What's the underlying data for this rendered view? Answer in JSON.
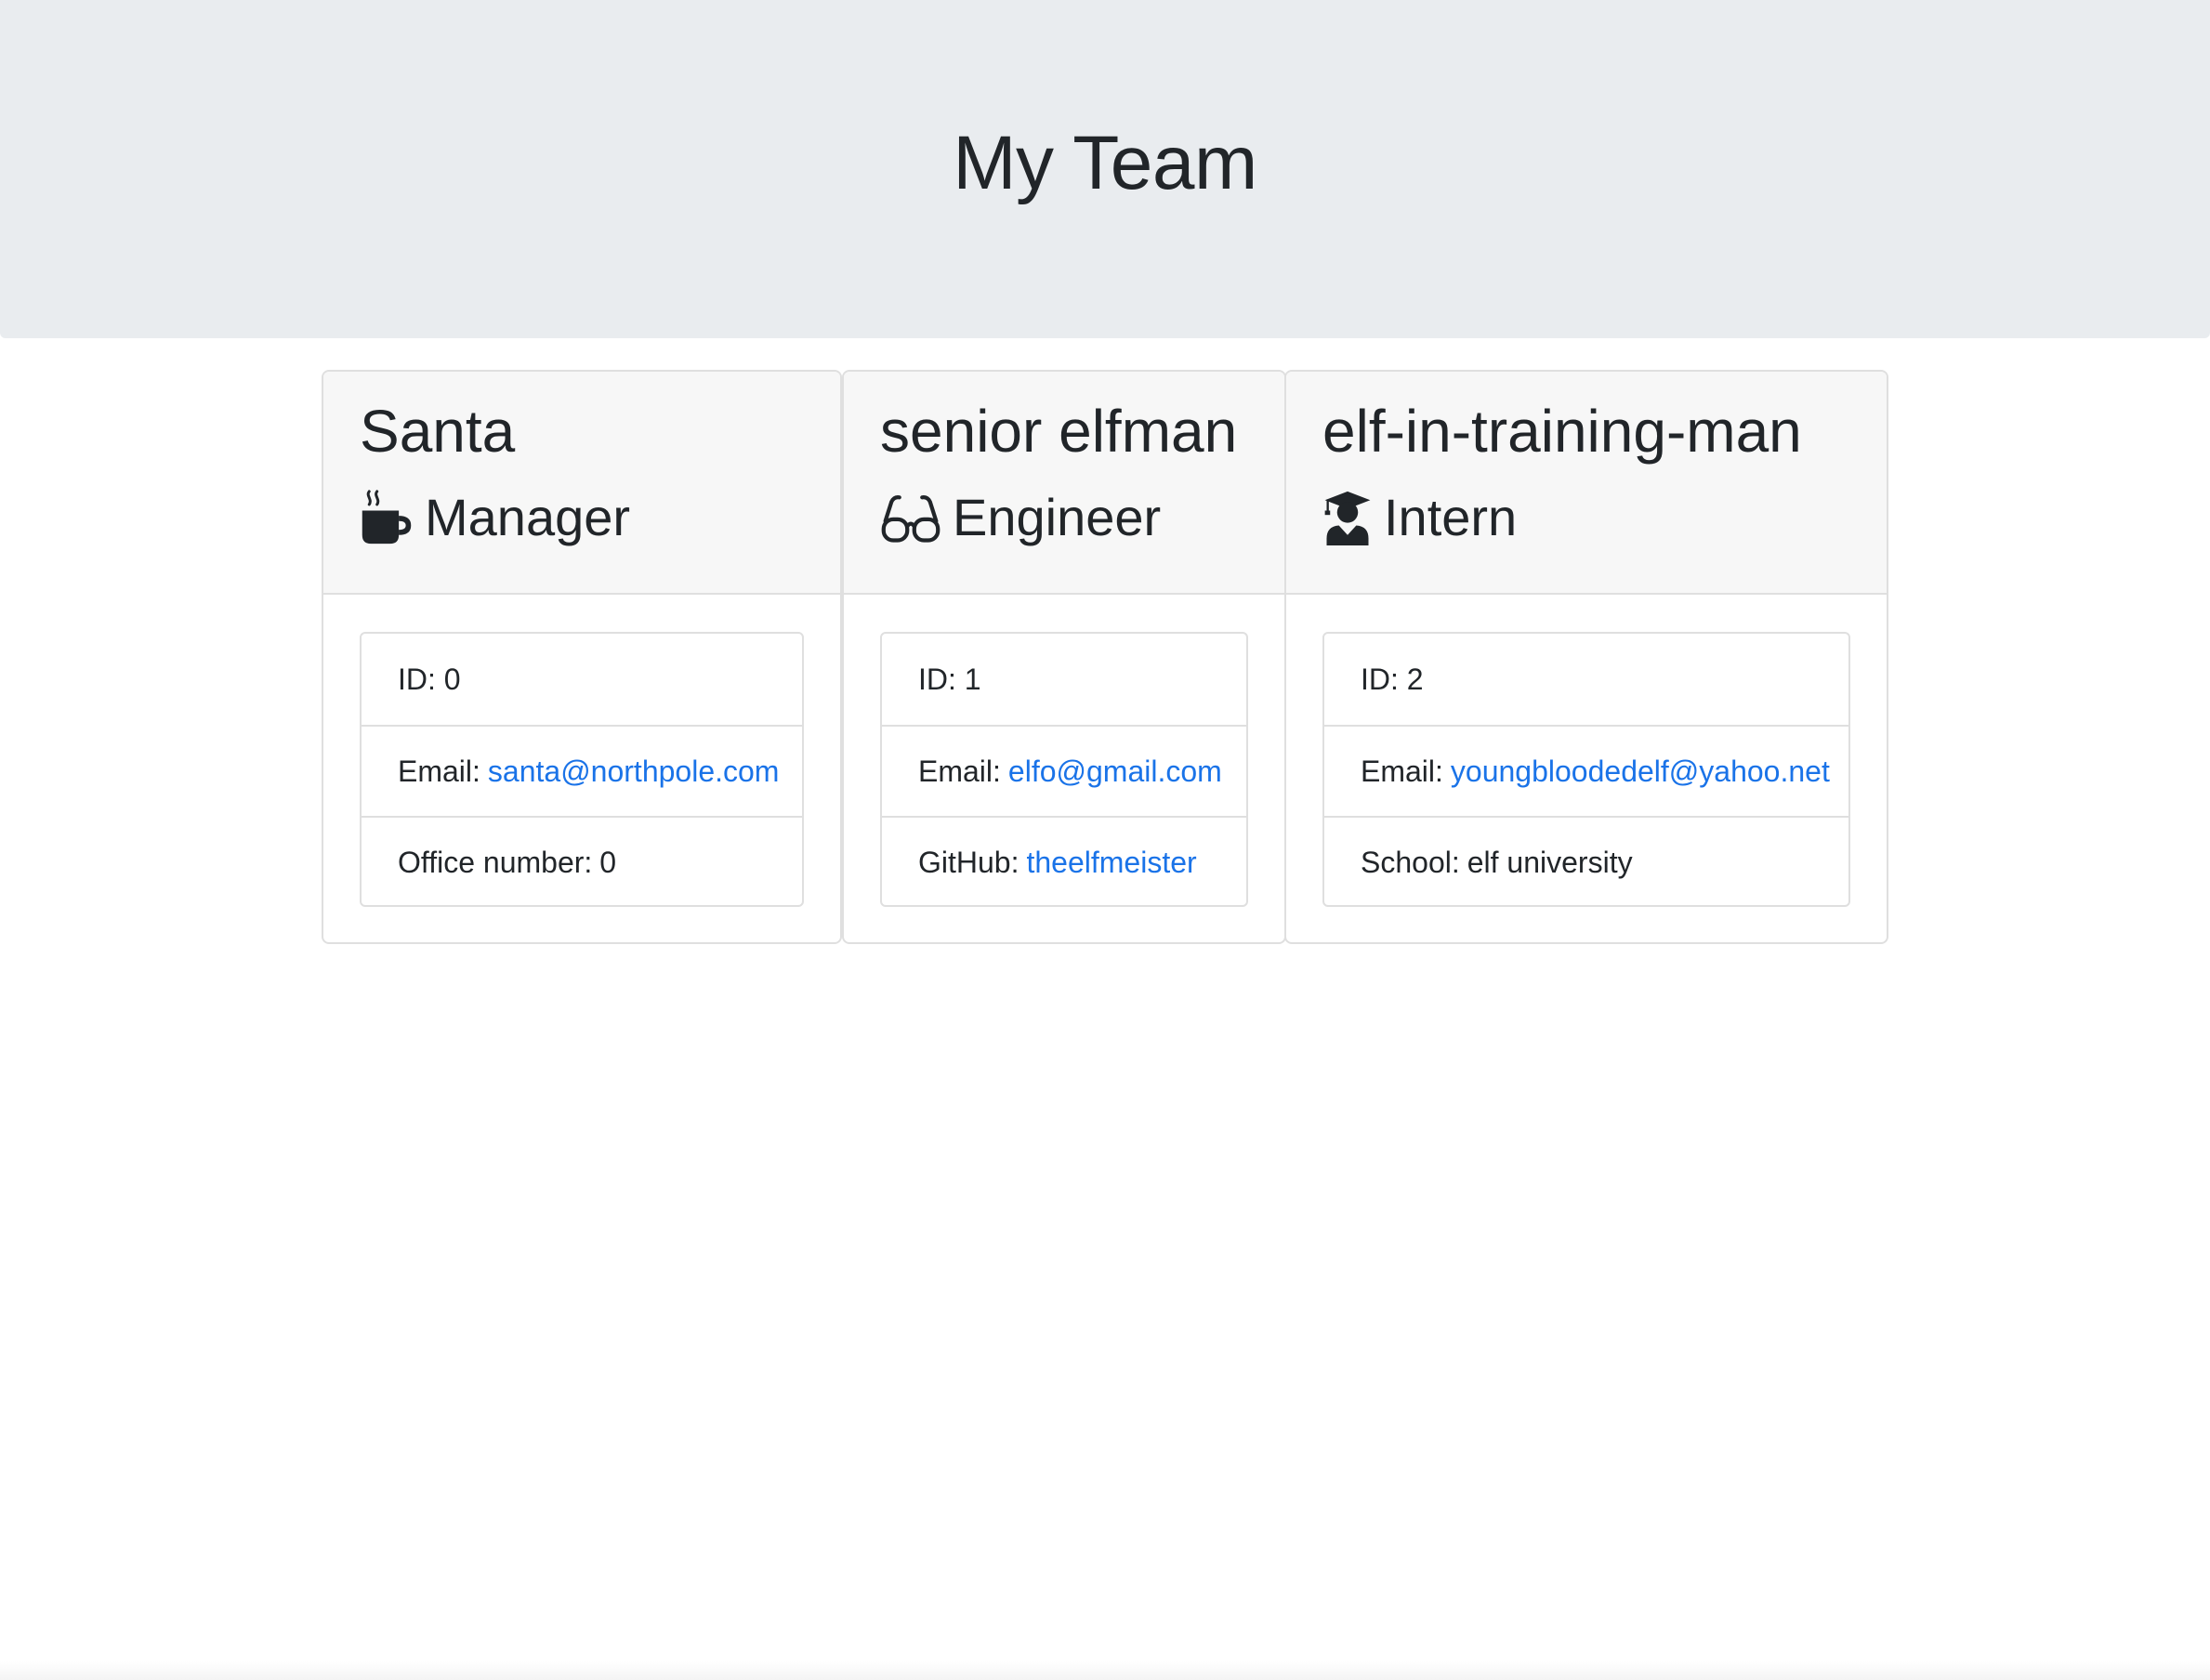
{
  "header": {
    "title": "My Team"
  },
  "team": [
    {
      "name": "Santa",
      "role": "Manager",
      "role_icon": "mug-hot-icon",
      "id_text": "ID: 0",
      "email_label": "Email:",
      "email": "santa@northpole.com",
      "extra_label": "Office number:",
      "extra_value": "0"
    },
    {
      "name": "senior elfman",
      "role": "Engineer",
      "role_icon": "glasses-icon",
      "id_text": "ID: 1",
      "email_label": "Email:",
      "email": "elfo@gmail.com",
      "extra_label": "GitHub:",
      "extra_value": "theelfmeister"
    },
    {
      "name": "elf-in-training-man",
      "role": "Intern",
      "role_icon": "user-graduate-icon",
      "id_text": "ID: 2",
      "email_label": "Email:",
      "email": "youngbloodedelf@yahoo.net",
      "extra_label": "School:",
      "extra_value": "elf university"
    }
  ],
  "colors": {
    "header_background": "#e9ecef",
    "card_header_background": "#f7f7f7",
    "link": "#1a73e8",
    "text": "#212529"
  }
}
